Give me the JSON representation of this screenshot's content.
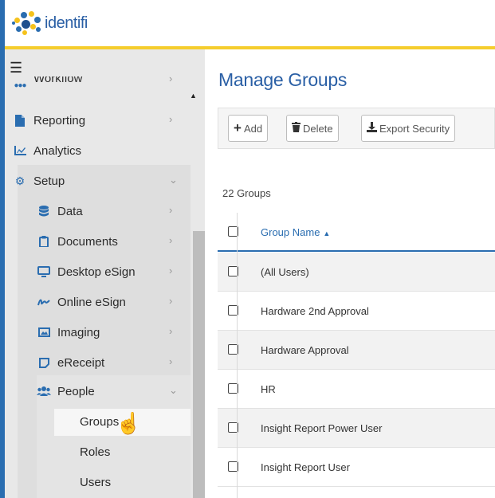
{
  "app": {
    "logo_text": "identifi"
  },
  "sidebar": {
    "menu_icon": "hamburger-icon",
    "items": [
      {
        "label": "Workflow",
        "icon": "workflow-icon"
      },
      {
        "label": "Reporting",
        "icon": "file-icon"
      },
      {
        "label": "Analytics",
        "icon": "chart-icon"
      },
      {
        "label": "Setup",
        "icon": "gear-icon"
      },
      {
        "label": "Data",
        "icon": "database-icon"
      },
      {
        "label": "Documents",
        "icon": "clipboard-icon"
      },
      {
        "label": "Desktop eSign",
        "icon": "monitor-icon"
      },
      {
        "label": "Online eSign",
        "icon": "signature-icon"
      },
      {
        "label": "Imaging",
        "icon": "image-icon"
      },
      {
        "label": "eReceipt",
        "icon": "note-icon"
      },
      {
        "label": "People",
        "icon": "users-icon"
      }
    ],
    "people_sub": [
      "Groups",
      "Roles",
      "Users"
    ]
  },
  "main": {
    "title": "Manage Groups",
    "toolbar": {
      "add": "Add",
      "delete": "Delete",
      "export": "Export Security"
    },
    "count": "22 Groups",
    "column_header": "Group Name",
    "rows": [
      "(All Users)",
      "Hardware 2nd Approval",
      "Hardware Approval",
      "HR",
      "Insight Report Power User",
      "Insight Report User"
    ]
  },
  "colors": {
    "accent": "#2a6db0",
    "header_border": "#f5cd2d",
    "sidebar_bg": "#e8e8e8"
  }
}
